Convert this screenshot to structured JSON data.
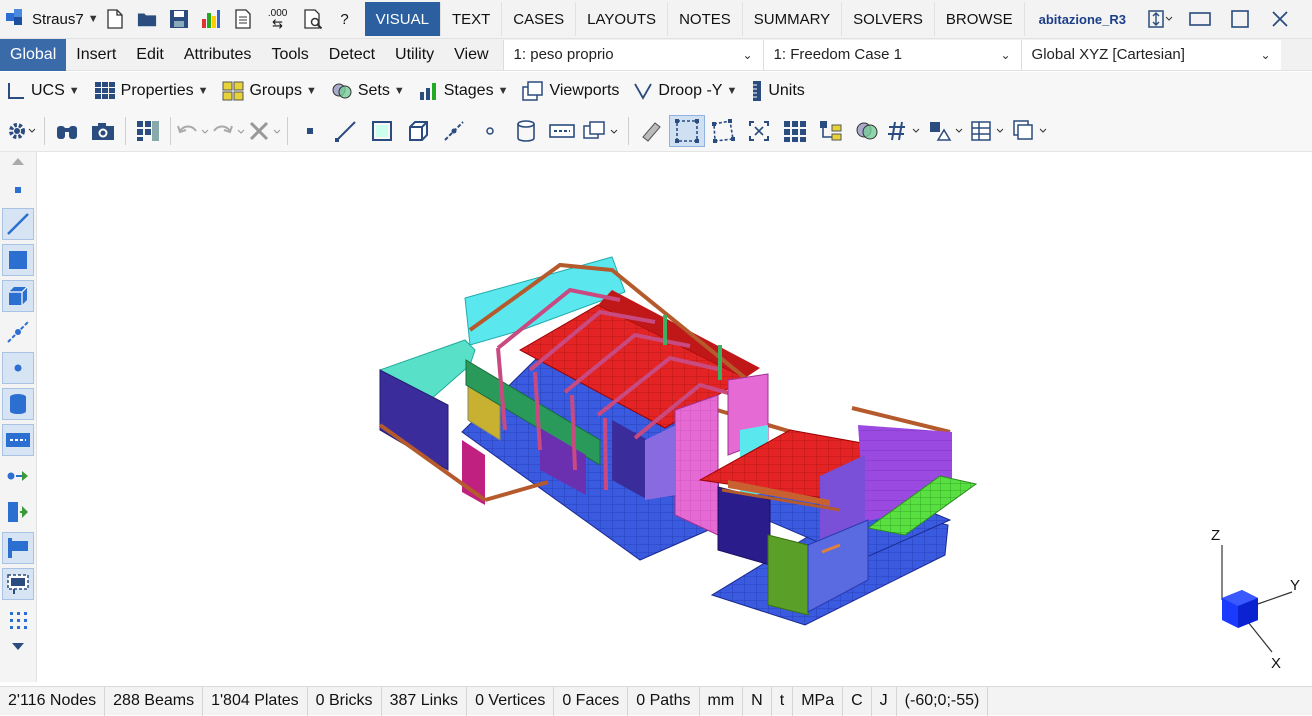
{
  "app": {
    "name": "Straus7"
  },
  "tabs": [
    {
      "label": "VISUAL",
      "active": true
    },
    {
      "label": "TEXT"
    },
    {
      "label": "CASES"
    },
    {
      "label": "LAYOUTS"
    },
    {
      "label": "NOTES"
    },
    {
      "label": "SUMMARY"
    },
    {
      "label": "SOLVERS"
    },
    {
      "label": "BROWSE"
    }
  ],
  "document": {
    "name": "abitazione_R3"
  },
  "menu": {
    "items": [
      "Global",
      "Insert",
      "Edit",
      "Attributes",
      "Tools",
      "Detect",
      "Utility",
      "View"
    ],
    "active": "Global"
  },
  "selectors": {
    "load_case": "1: peso proprio",
    "freedom_case": "1: Freedom Case 1",
    "coord_system": "Global XYZ [Cartesian]"
  },
  "toolbar1": {
    "ucs": "UCS",
    "properties": "Properties",
    "groups": "Groups",
    "sets": "Sets",
    "stages": "Stages",
    "viewports": "Viewports",
    "droop": "Droop -Y",
    "units": "Units"
  },
  "toolbar_icons": {
    "decimals": ".000"
  },
  "axes": {
    "z": "Z",
    "y": "Y",
    "x": "X"
  },
  "status": {
    "nodes": "2'116 Nodes",
    "beams": "288 Beams",
    "plates": "1'804 Plates",
    "bricks": "0 Bricks",
    "links": "387 Links",
    "vertices": "0 Vertices",
    "faces": "0 Faces",
    "paths": "0 Paths",
    "unit_length": "mm",
    "unit_force": "N",
    "unit_mass": "t",
    "unit_stress": "MPa",
    "unit_temp": "C",
    "unit_energy": "J",
    "view_angles": "(-60;0;-55)"
  },
  "colors": {
    "accent": "#2c5fa0",
    "slab": "#3c5ce0",
    "roof": "#e02020",
    "wall_cyan": "#55e6ea",
    "wall_purple": "#3a2c9a",
    "wall_magenta": "#e860d0",
    "wall_violet": "#8a4ad8",
    "beam_brown": "#b55a2c",
    "green_panel": "#58e040",
    "wall_olive": "#5aa028"
  }
}
